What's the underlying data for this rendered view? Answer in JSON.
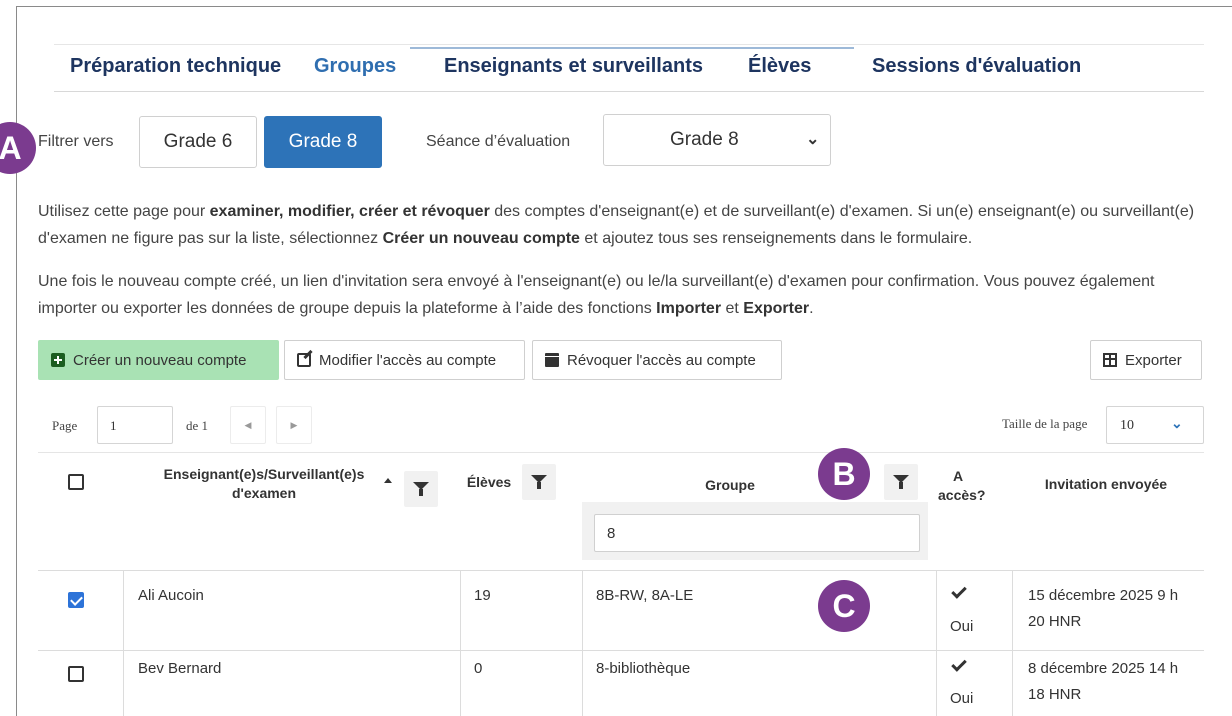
{
  "tabs": [
    {
      "label": "Préparation technique"
    },
    {
      "label": "Groupes"
    },
    {
      "label": "Enseignants et surveillants"
    },
    {
      "label": "Élèves"
    },
    {
      "label": "Sessions d'évaluation"
    }
  ],
  "filter": {
    "label": "Filtrer vers",
    "grades": [
      "Grade 6",
      "Grade 8"
    ],
    "active_grade": "Grade 8",
    "seance_label": "Séance d’évaluation",
    "seance_value": "Grade 8"
  },
  "annotations": {
    "a": "A",
    "b": "B",
    "c": "C"
  },
  "intro": {
    "p1": [
      "Utilisez cette page pour ",
      "examiner, modifier, créer et révoquer",
      " des comptes d'enseignant(e) et de surveillant(e) d'examen. Si un(e) enseignant(e) ou surveillant(e) d'examen ne figure pas sur la liste, sélectionnez ",
      "Créer un nouveau compte",
      " et ajoutez tous ses renseignements dans le formulaire."
    ],
    "p2": [
      "Une fois le nouveau compte créé, un lien d'invitation sera envoyé à l'enseignant(e) ou le/la surveillant(e) d'examen pour confirmation. Vous pouvez également importer ou exporter les données de groupe depuis la plateforme à l’aide des fonctions ",
      "Importer",
      " et ",
      "Exporter",
      "."
    ]
  },
  "toolbar": {
    "create": "Créer un nouveau compte",
    "modify": "Modifier l'accès au compte",
    "revoke": "Révoquer l'accès au compte",
    "export": "Exporter"
  },
  "pagination": {
    "page_label": "Page",
    "page_value": "1",
    "of_label": "de 1",
    "prev": "◀",
    "next": "▶",
    "size_label": "Taille de la page",
    "size_value": "10",
    "size_chevron": "⌄"
  },
  "table": {
    "headers": {
      "teacher": "Enseignant(e)s/Surveillant(e)s d'examen",
      "students": "Élèves",
      "group": "Groupe",
      "access": "A accès?",
      "invitation": "Invitation envoyée"
    },
    "group_filter_value": "8",
    "rows": [
      {
        "name": "Ali Aucoin",
        "students": "19",
        "group": "8B-RW, 8A-LE",
        "access": "Oui",
        "invitation": "15 décembre 2025 9 h 20 HNR",
        "checked": true
      },
      {
        "name": "Bev Bernard",
        "students": "0",
        "group": "8-bibliothèque",
        "access": "Oui",
        "invitation": "8 décembre 2025 14 h 18 HNR",
        "checked": false
      }
    ]
  },
  "colors": {
    "accent": "#2d73b8",
    "badge": "#7b3b8f",
    "create_bg": "#a9e2b4",
    "tab_text": "#1e3560"
  }
}
